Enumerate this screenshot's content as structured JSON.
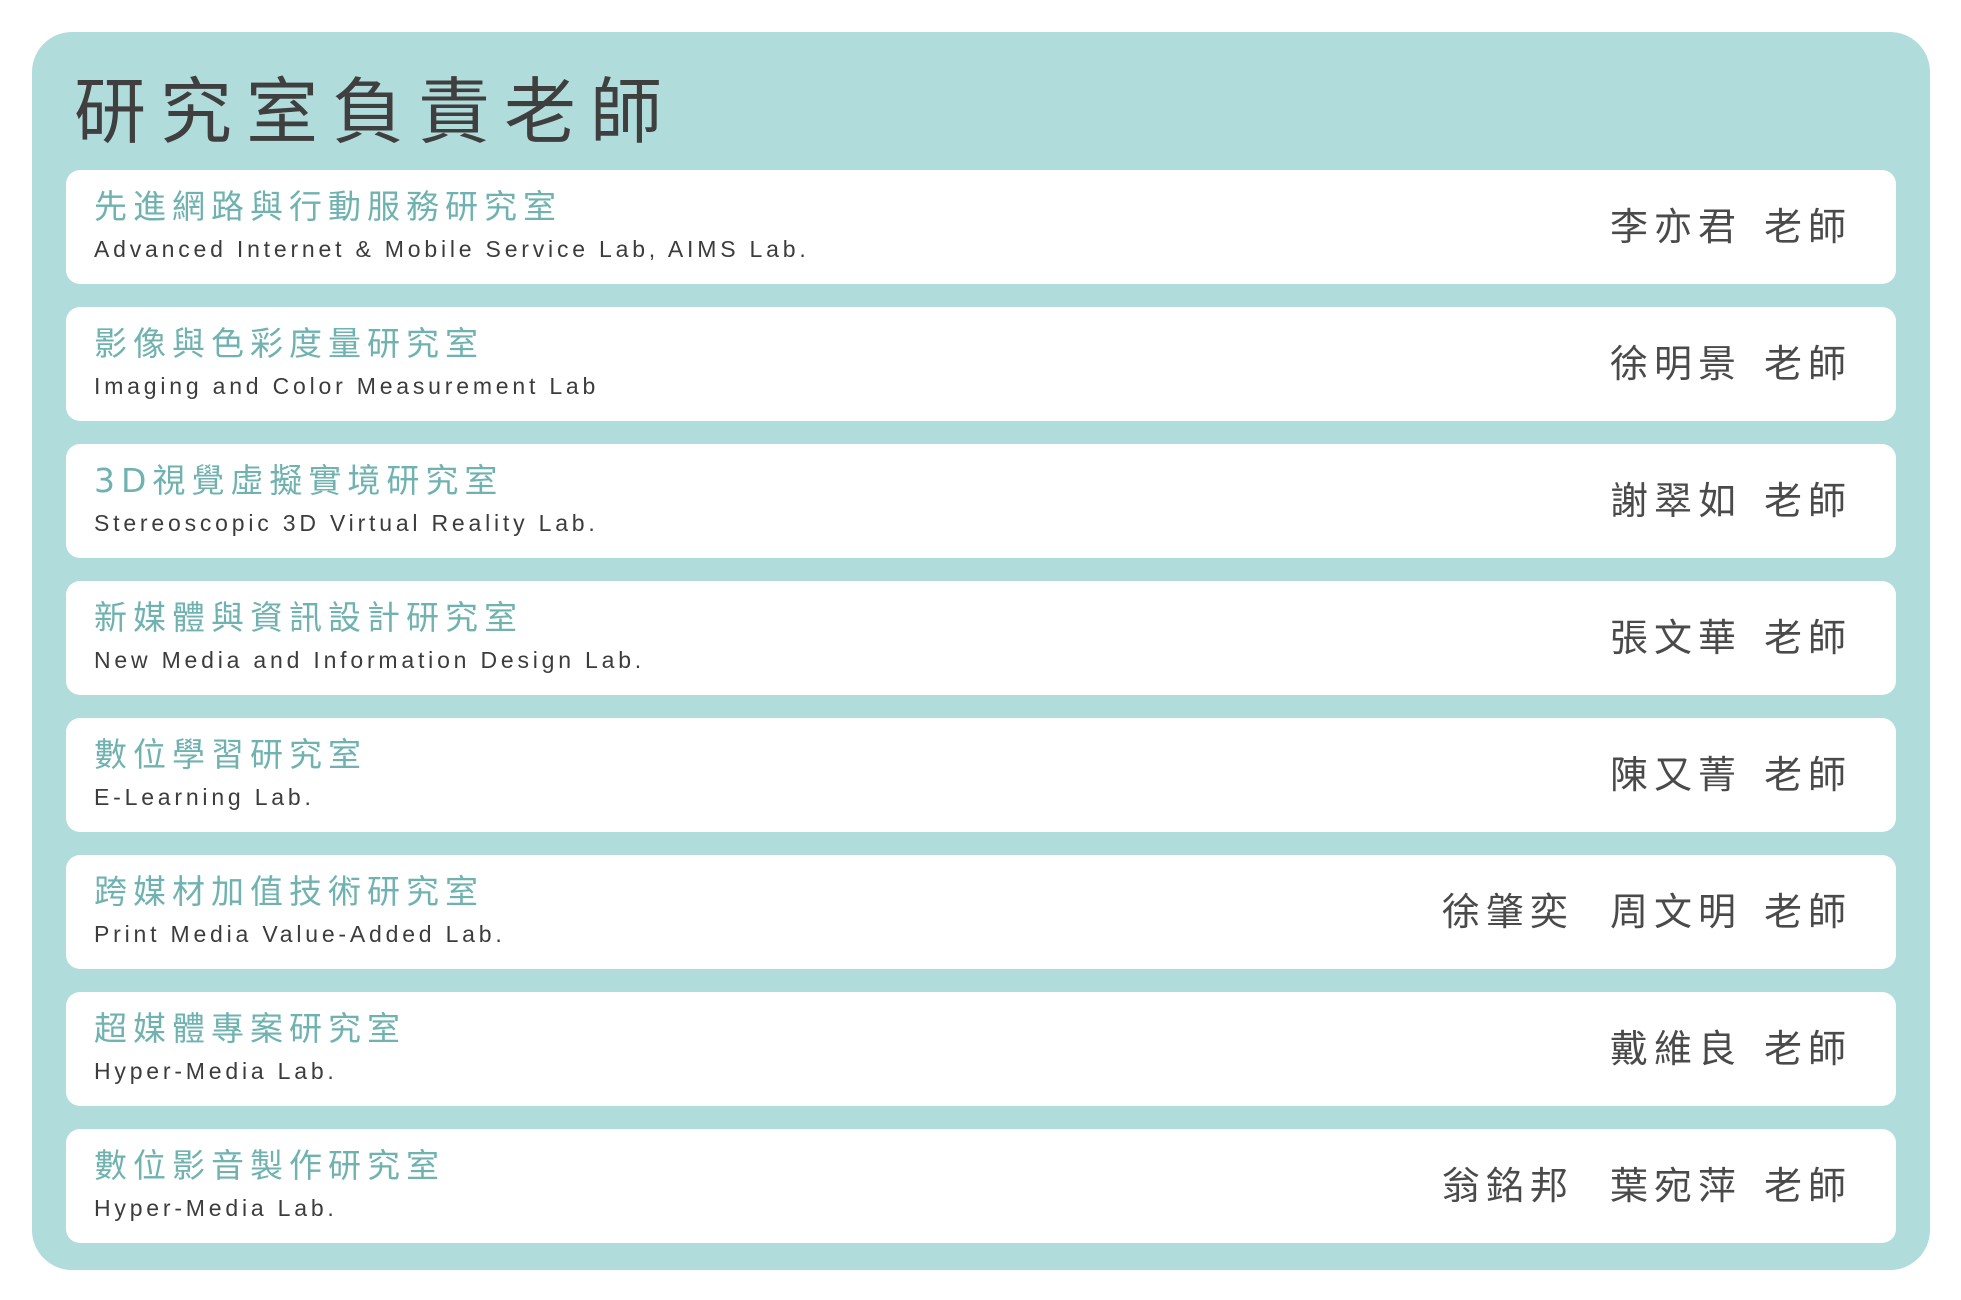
{
  "title": "研究室負責老師",
  "labs": [
    {
      "name_zh": "先進網路與行動服務研究室",
      "name_en": "Advanced Internet & Mobile Service Lab, AIMS Lab.",
      "advisors": "李亦君",
      "suffix": "老師"
    },
    {
      "name_zh": "影像與色彩度量研究室",
      "name_en": "Imaging and Color Measurement Lab",
      "advisors": "徐明景",
      "suffix": "老師"
    },
    {
      "name_zh": "3D視覺虛擬實境研究室",
      "name_en": "Stereoscopic 3D Virtual Reality Lab.",
      "advisors": "謝翠如",
      "suffix": "老師"
    },
    {
      "name_zh": "新媒體與資訊設計研究室",
      "name_en": "New Media and Information Design Lab.",
      "advisors": "張文華",
      "suffix": "老師"
    },
    {
      "name_zh": "數位學習研究室",
      "name_en": "E-Learning Lab.",
      "advisors": "陳又菁",
      "suffix": "老師"
    },
    {
      "name_zh": "跨媒材加值技術研究室",
      "name_en": "Print Media Value-Added Lab.",
      "advisors": "徐肇奕  周文明",
      "suffix": "老師"
    },
    {
      "name_zh": "超媒體專案研究室",
      "name_en": "Hyper-Media Lab.",
      "advisors": "戴維良",
      "suffix": "老師"
    },
    {
      "name_zh": "數位影音製作研究室",
      "name_en": "Hyper-Media Lab.",
      "advisors": "翁銘邦  葉宛萍",
      "suffix": "老師"
    }
  ]
}
